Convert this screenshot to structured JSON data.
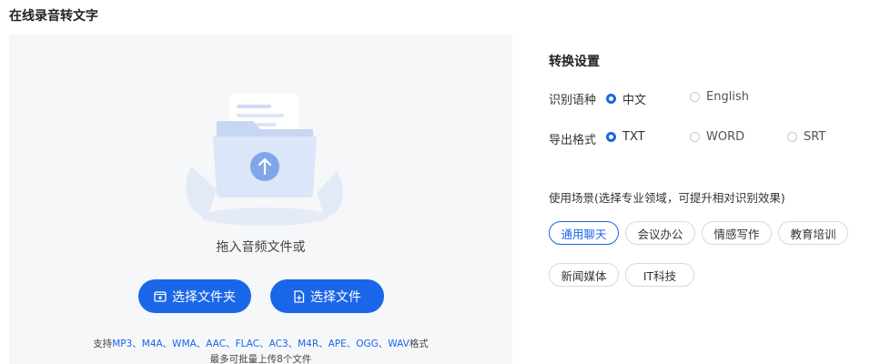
{
  "page": {
    "title": "在线录音转文字"
  },
  "upload": {
    "drop_text": "拖入音频文件或",
    "folder_button": "选择文件夹",
    "file_button": "选择文件",
    "support_prefix": "支持",
    "support_formats": "MP3、M4A、WMA、AAC、FLAC、AC3、M4R、APE、OGG、WAV",
    "support_suffix": "格式",
    "limit": "最多可批量上传8个文件"
  },
  "settings": {
    "title": "转换设置",
    "language": {
      "label": "识别语种",
      "options": [
        {
          "label": "中文",
          "selected": true
        },
        {
          "label": "English",
          "selected": false
        }
      ]
    },
    "format": {
      "label": "导出格式",
      "options": [
        {
          "label": "TXT",
          "selected": true
        },
        {
          "label": "WORD",
          "selected": false
        },
        {
          "label": "SRT",
          "selected": false
        }
      ]
    },
    "scene": {
      "label": "使用场景(选择专业领域，可提升相对识别效果)",
      "chips": [
        {
          "label": "通用聊天",
          "active": true
        },
        {
          "label": "会议办公",
          "active": false
        },
        {
          "label": "情感写作",
          "active": false
        },
        {
          "label": "教育培训",
          "active": false
        },
        {
          "label": "新闻媒体",
          "active": false
        },
        {
          "label": "IT科技",
          "active": false
        }
      ]
    }
  },
  "colors": {
    "accent": "#1a66e8",
    "panel_bg": "#f6f7f9"
  },
  "icons": {
    "upload": "upload-arrow-icon",
    "folder": "folder-add-icon",
    "file": "file-add-icon"
  }
}
